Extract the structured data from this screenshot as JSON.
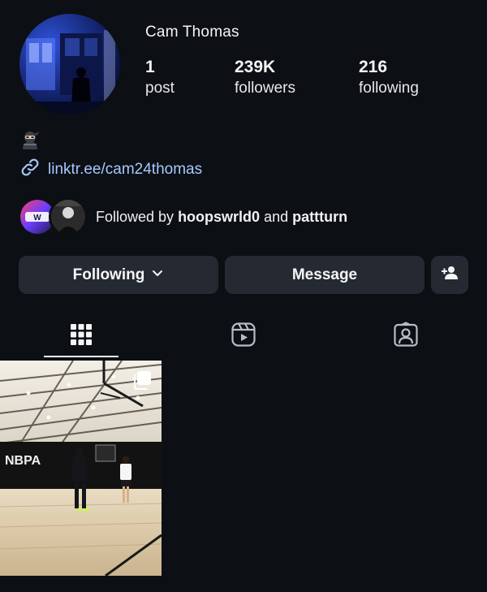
{
  "profile": {
    "username": "Cam Thomas",
    "bio_emoji": "ninja",
    "link": "linktr.ee/cam24thomas"
  },
  "stats": {
    "posts": {
      "value": "1",
      "label": "post"
    },
    "followers": {
      "value": "239K",
      "label": "followers"
    },
    "following": {
      "value": "216",
      "label": "following"
    }
  },
  "followed_by": {
    "prefix": "Followed by",
    "user1": "hoopswrld0",
    "conjunction": "and",
    "user2": "pattturn"
  },
  "actions": {
    "following_label": "Following",
    "message_label": "Message"
  },
  "tabs": [
    {
      "name": "grid",
      "icon": "grid-icon",
      "active": true
    },
    {
      "name": "reels",
      "icon": "reels-icon",
      "active": false
    },
    {
      "name": "tagged",
      "icon": "tagged-icon",
      "active": false
    }
  ],
  "posts": [
    {
      "watermark": "NBPA",
      "multi": true
    }
  ],
  "colors": {
    "background": "#0c0f14",
    "button": "#252931",
    "link": "#a6c8ff",
    "text": "#f5f5f5"
  }
}
